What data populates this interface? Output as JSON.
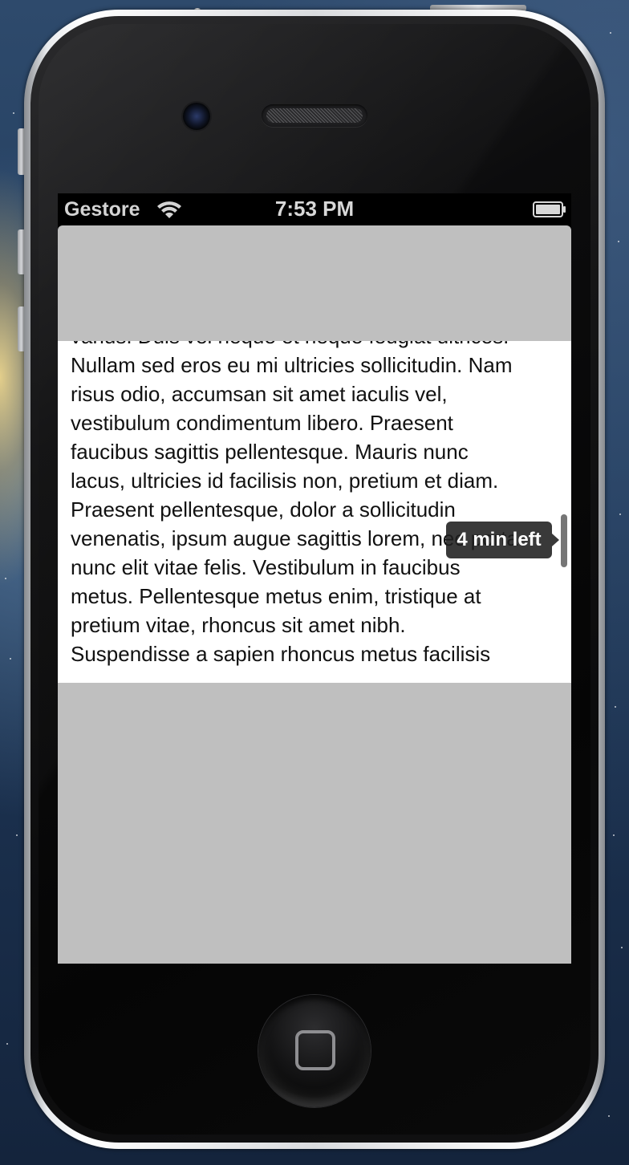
{
  "status_bar": {
    "carrier": "Gestore",
    "time": "7:53 PM",
    "wifi_icon": "wifi-icon",
    "battery_icon": "battery-icon",
    "battery_level": 1.0
  },
  "article": {
    "lines": [
      "varius. Duis vel neque et neque feugiat ultrices.",
      "Nullam sed eros eu mi ultricies sollicitudin. Nam",
      "risus odio, accumsan sit amet iaculis vel,",
      "vestibulum condimentum libero. Praesent",
      "faucibus sagittis pellentesque. Mauris nunc",
      "lacus, ultricies id facilisis non, pretium et diam.",
      "Praesent pellentesque, dolor a sollicitudin",
      "venenatis, ipsum augue sagittis lorem, nec porta",
      "nunc elit vitae felis. Vestibulum in faucibus",
      "metus. Pellentesque metus enim, tristique at",
      "pretium vitae, rhoncus sit amet nibh.",
      "Suspendisse a sapien rhoncus metus facilisis"
    ]
  },
  "reading_indicator": {
    "label": "4 min left"
  },
  "device": {
    "home_icon": "home-button-icon",
    "camera_icon": "front-camera-icon",
    "speaker_icon": "earpiece-speaker-icon"
  },
  "colors": {
    "app_background": "#bfbfbf",
    "text_panel": "#ffffff",
    "status_bar": "#000000",
    "bubble": "#1e1e1e"
  }
}
